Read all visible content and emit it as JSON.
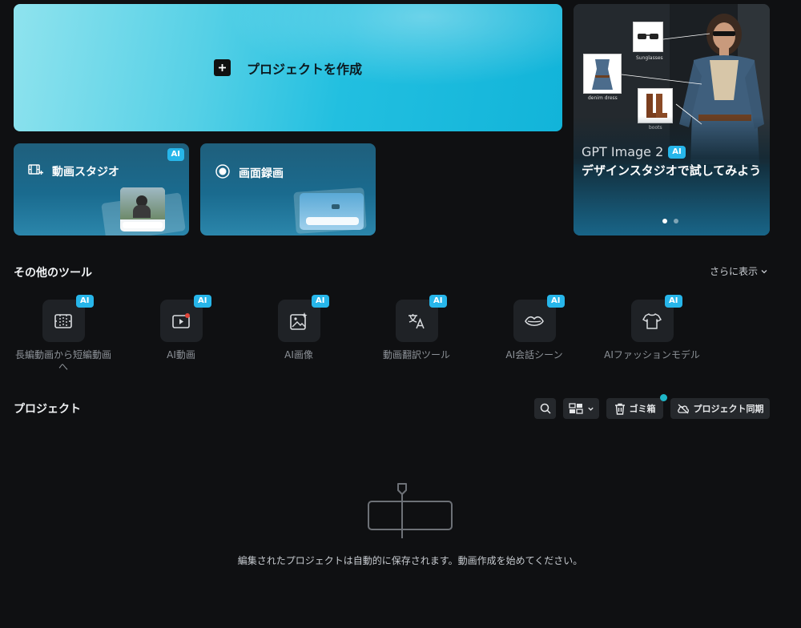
{
  "create": {
    "label": "プロジェクトを作成"
  },
  "features": {
    "studio": {
      "label": "動画スタジオ",
      "badge": "AI"
    },
    "record": {
      "label": "画面録画"
    }
  },
  "banner": {
    "title": "GPT Image 2",
    "badge": "AI",
    "subtitle": "デザインスタジオで試してみよう",
    "callouts": [
      "Sunglasses",
      "denim dress",
      "boots"
    ]
  },
  "tools_section": {
    "title": "その他のツール",
    "more_label": "さらに表示",
    "items": [
      {
        "label": "長編動画から短編動画へ",
        "badge": "AI",
        "icon": "film-cut-icon"
      },
      {
        "label": "AI動画",
        "badge": "AI",
        "icon": "video-play-icon"
      },
      {
        "label": "AI画像",
        "badge": "AI",
        "icon": "image-sparkle-icon"
      },
      {
        "label": "動画翻訳ツール",
        "badge": "AI",
        "icon": "translate-icon"
      },
      {
        "label": "AI会話シーン",
        "badge": "AI",
        "icon": "lips-icon"
      },
      {
        "label": "AIファッションモデル",
        "badge": "AI",
        "icon": "shirt-icon"
      }
    ]
  },
  "projects": {
    "title": "プロジェクト",
    "trash_label": "ゴミ箱",
    "sync_label": "プロジェクト同期",
    "empty_message": "編集されたプロジェクトは自動的に保存されます。動画作成を始めてください。"
  }
}
